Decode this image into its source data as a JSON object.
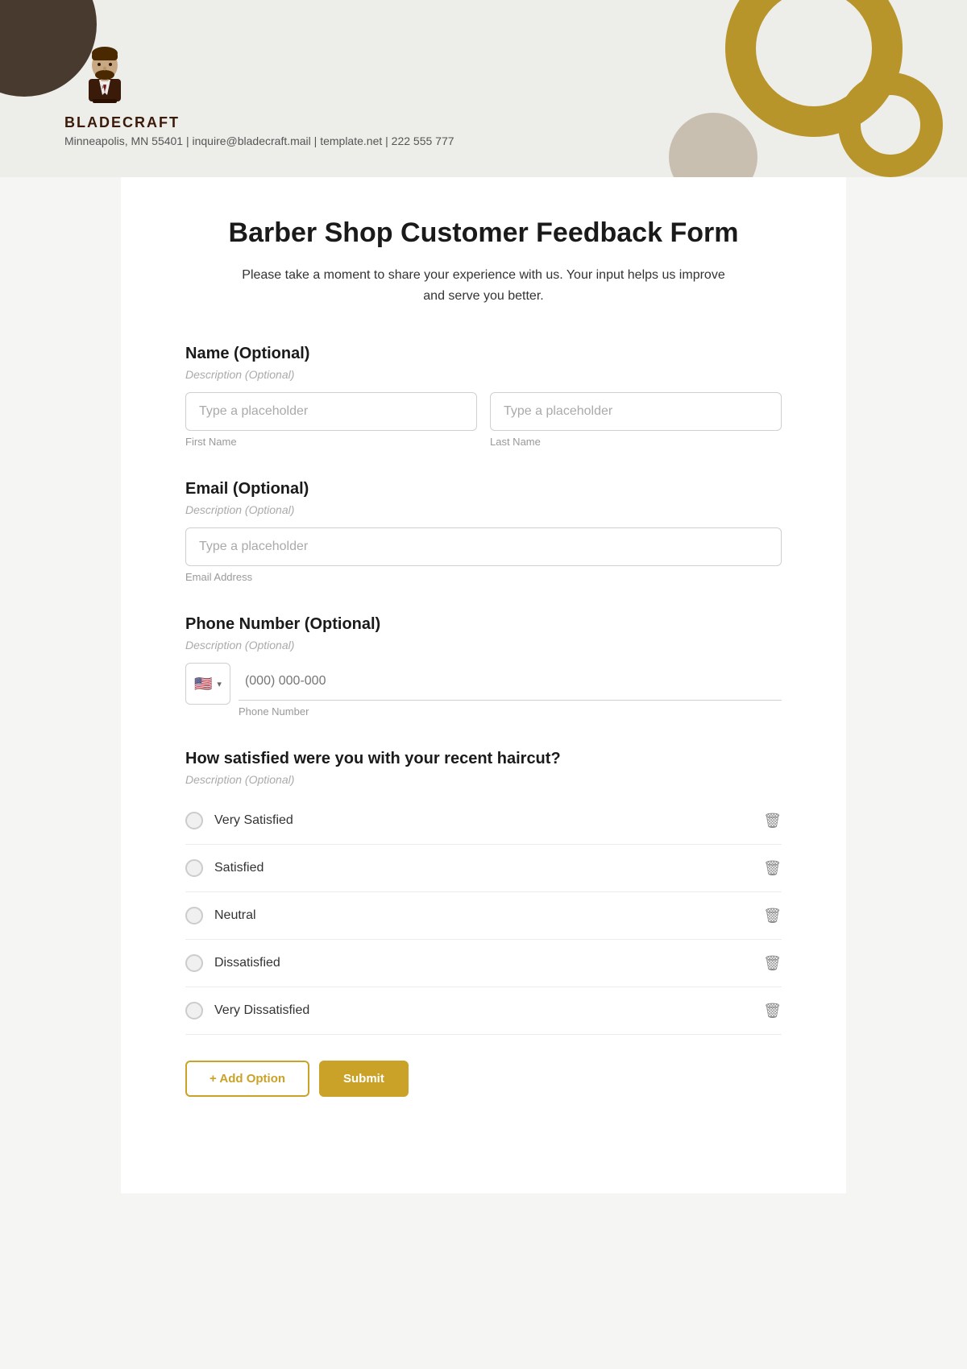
{
  "header": {
    "logo_text": "BLADECRAFT",
    "contact_info": "Minneapolis, MN 55401 | inquire@bladecraft.mail | template.net | 222 555 777"
  },
  "form": {
    "title": "Barber Shop Customer Feedback Form",
    "description": "Please take a moment to share your experience with us. Your input helps us improve and serve you better.",
    "sections": [
      {
        "id": "name",
        "label": "Name (Optional)",
        "description": "Description (Optional)",
        "fields": [
          {
            "placeholder": "Type a placeholder",
            "sub_label": "First Name"
          },
          {
            "placeholder": "Type a placeholder",
            "sub_label": "Last Name"
          }
        ]
      },
      {
        "id": "email",
        "label": "Email  (Optional)",
        "description": "Description (Optional)",
        "fields": [
          {
            "placeholder": "Type a placeholder",
            "sub_label": "Email Address"
          }
        ]
      },
      {
        "id": "phone",
        "label": "Phone Number  (Optional)",
        "description": "Description (Optional)",
        "country": {
          "flag": "🇺🇸",
          "code": ""
        },
        "placeholder": "(000) 000-000",
        "sub_label": "Phone Number"
      },
      {
        "id": "satisfaction",
        "label": "How satisfied were you with your recent haircut?",
        "description": "Description (Optional)",
        "options": [
          "Very Satisfied",
          "Satisfied",
          "Neutral",
          "Dissatisfied",
          "Very Dissatisfied"
        ]
      }
    ],
    "buttons": {
      "add_label": "+ Add Option",
      "submit_label": "Submit"
    }
  }
}
